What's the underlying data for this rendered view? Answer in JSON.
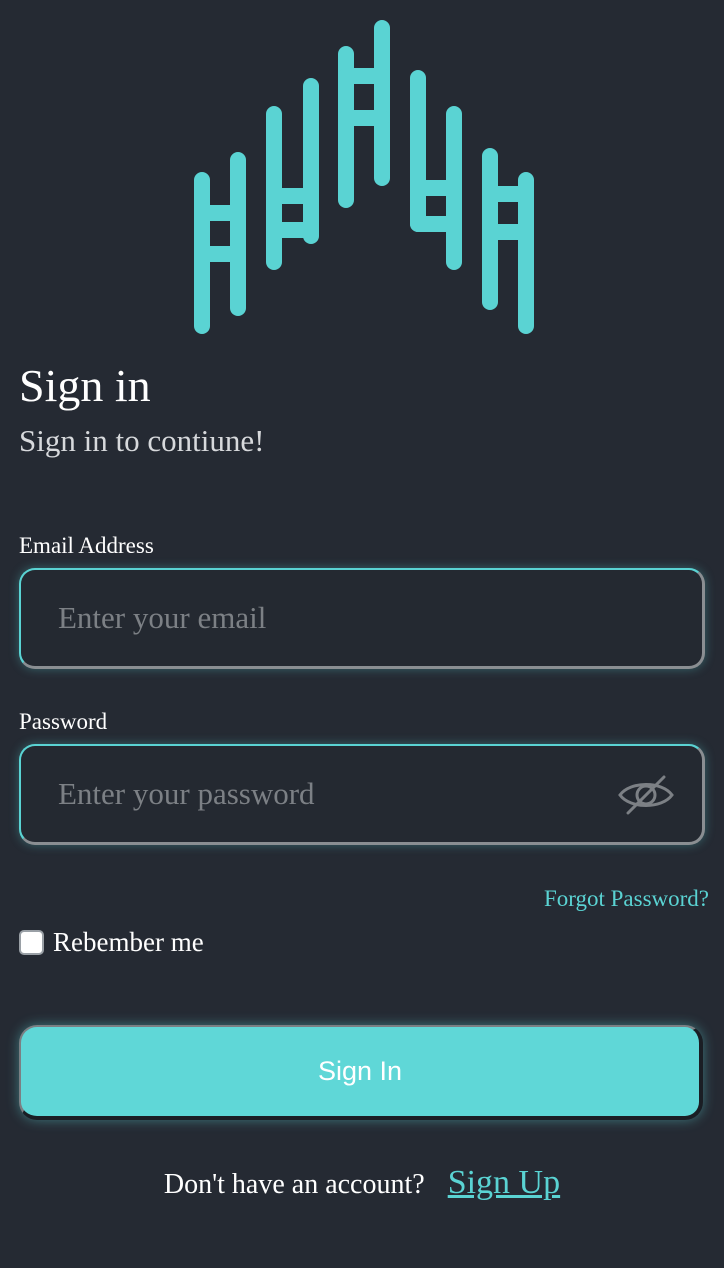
{
  "header": {
    "logo_icon": "sound-wave-house-logo-icon",
    "title": "Sign in",
    "subtitle": "Sign in to contiune!"
  },
  "form": {
    "email": {
      "label": "Email Address",
      "placeholder": "Enter your email",
      "value": ""
    },
    "password": {
      "label": "Password",
      "placeholder": "Enter your password",
      "value": "",
      "toggle_icon": "eye-slash-icon"
    },
    "forgot_password_label": "Forgot Password?",
    "remember_me": {
      "label": "Rebember me",
      "checked": false
    },
    "submit_label": "Sign In"
  },
  "footer": {
    "prompt": "Don't have an account?",
    "signup_label": "Sign Up"
  },
  "colors": {
    "background": "#252a33",
    "accent": "#5ad3d3",
    "button": "#5fd7d7",
    "placeholder": "#7c8085"
  }
}
